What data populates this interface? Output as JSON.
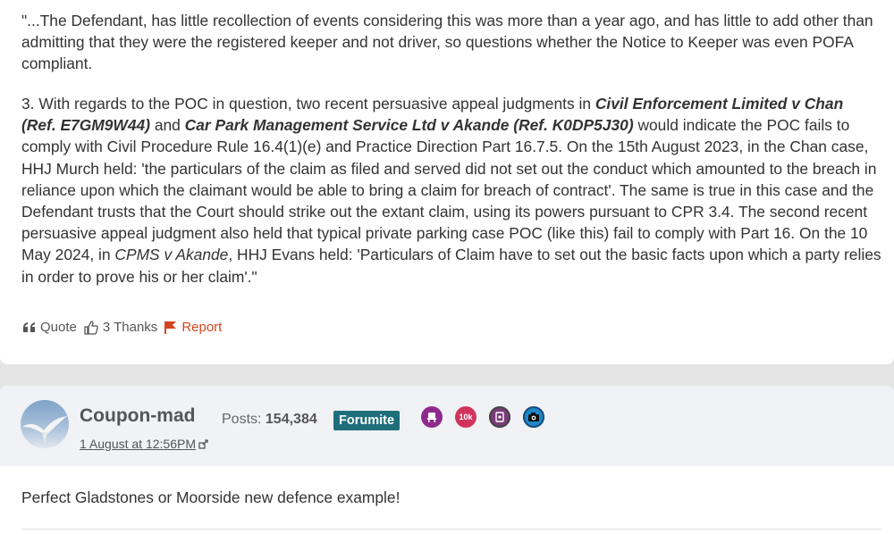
{
  "post1": {
    "para1": "\"...The Defendant, has little recollection of events considering this was more than a year ago, and has little to add other than admitting that they were the registered keeper and not driver, so questions whether the Notice to Keeper was even POFA compliant.",
    "para2": {
      "t1": "3. With regards to the POC in question, two recent persuasive appeal judgments in ",
      "case1": "Civil Enforcement Limited v Chan (Ref. E7GM9W44)",
      "t2": " and ",
      "case2": "Car Park Management Service Ltd v Akande (Ref. K0DP5J30)",
      "t3": " would indicate the POC fails to comply with Civil Procedure Rule 16.4(1)(e) and Practice Direction Part 16.7.5. On the 15th August 2023, in the Chan case, HHJ Murch held: 'the particulars of the claim as filed and served did not set out the conduct which amounted to the breach in reliance upon which the claimant would be able to bring a claim for breach of contract'. The same is true in this case and the Defendant trusts that the Court should strike out the extant claim, using its powers pursuant to CPR 3.4. The second recent persuasive appeal judgment also held that typical private parking case POC (like this) fail to comply with Part 16. On the 10 May 2024, in ",
      "case3": "CPMS v Akande",
      "t4": ", HHJ Evans held: 'Particulars of Claim have to set out the basic facts upon which a party relies in order to prove his or her claim'.\""
    },
    "actions": {
      "quote": "Quote",
      "thanks": "3 Thanks",
      "report": "Report"
    }
  },
  "post2": {
    "username": "Coupon-mad",
    "posts_label": "Posts: ",
    "posts_count": "154,384",
    "rank": "Forumite",
    "badges": [
      {
        "icon": "chair-badge-icon",
        "text": "",
        "color": "#8e2a8e"
      },
      {
        "icon": "10k-badge-icon",
        "text": "10k",
        "color": "#d1345b"
      },
      {
        "icon": "book-badge-icon",
        "text": "",
        "color": "#7a3b7a"
      },
      {
        "icon": "camera-badge-icon",
        "text": "",
        "color": "#1e88c8"
      }
    ],
    "timestamp": "1 August at 12:56PM",
    "body": "Perfect Gladstones or Moorside new defence example!"
  }
}
